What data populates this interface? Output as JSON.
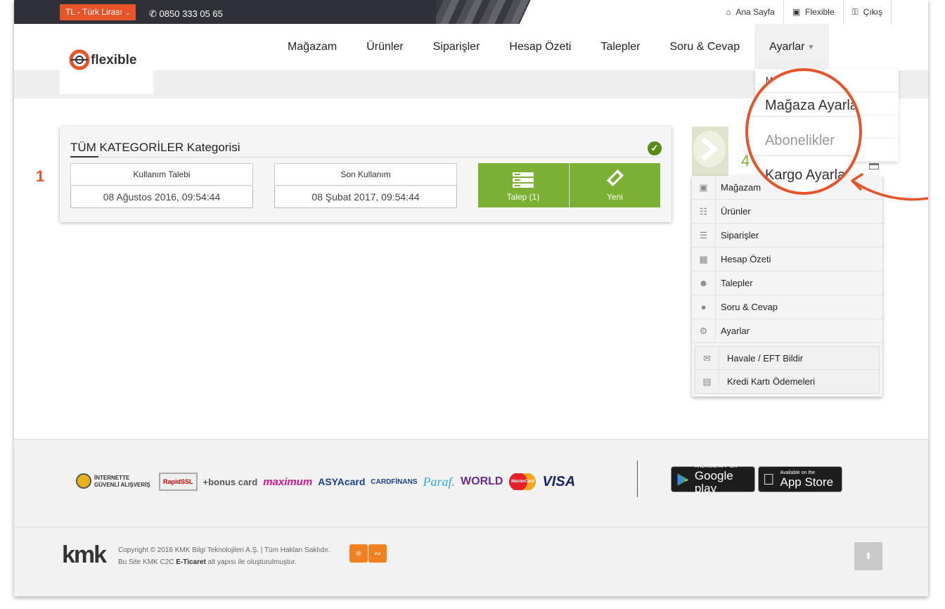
{
  "topbar": {
    "currency": "TL - Türk Lirası",
    "phone": "0850 333 05 65",
    "links": [
      {
        "label": "Ana Sayfa",
        "icon": "home-icon"
      },
      {
        "label": "Flexible",
        "icon": "cube-icon"
      },
      {
        "label": "Çıkış",
        "icon": "unlock-icon"
      }
    ]
  },
  "logo_text": "flexible",
  "nav": {
    "items": [
      "Mağazam",
      "Ürünler",
      "Siparişler",
      "Hesap Özeti",
      "Talepler",
      "Soru & Cevap"
    ],
    "active": "Ayarlar"
  },
  "dropdown": {
    "items": [
      "Mağaza Ayarları",
      "Mağaza Ayarları",
      "Abonelikler",
      "Kargo Ayarları"
    ]
  },
  "zoom": {
    "items": [
      "Mağaza Ayarları",
      "Abonelikler",
      "Kargo Ayarları"
    ]
  },
  "row_number": "1",
  "card": {
    "title": "TÜM KATEGORİLER Kategorisi",
    "usage_request_label": "Kullanım Talebi",
    "usage_request_value": "08 Ağustos 2016, 09:54:44",
    "last_usage_label": "Son Kullanım",
    "last_usage_value": "08 Şubat 2017, 09:54:44",
    "request_button": "Talep (1)",
    "new_button": "Yeni"
  },
  "side": {
    "count": "4",
    "menu": [
      {
        "label": "Mağazam",
        "icon": "cube-icon"
      },
      {
        "label": "Ürünler",
        "icon": "barcode-icon"
      },
      {
        "label": "Siparişler",
        "icon": "list-icon"
      },
      {
        "label": "Hesap Özeti",
        "icon": "calculator-icon"
      },
      {
        "label": "Talepler",
        "icon": "users-icon"
      },
      {
        "label": "Soru & Cevap",
        "icon": "comment-icon"
      },
      {
        "label": "Ayarlar",
        "icon": "cogs-icon"
      }
    ],
    "submenu": [
      {
        "label": "Havale / EFT Bildir",
        "icon": "megaphone-icon"
      },
      {
        "label": "Kredi Kartı Ödemeleri",
        "icon": "credit-card-icon"
      }
    ]
  },
  "footer": {
    "payments": [
      "İNTERNETTE GÜVENLİ ALIŞVERİŞ",
      "RapidSSL",
      "+bonus card",
      "maximum",
      "ASYAcard",
      "CARDFİNANS",
      "Paraf.",
      "WORLD",
      "MasterCard",
      "VISA"
    ],
    "android_small": "ANDROID APP ON",
    "android_big": "Google play",
    "apple_small": "Available on the",
    "apple_big": "App Store",
    "kmk": "kmk",
    "copyright_line1": "Copyright © 2016 KMK Bilgi Teknolojileri A.Ş. | Tüm Hakları Saklıdır.",
    "copyright_line2_pre": "Bu Site KMK C2C",
    "copyright_line2_bold": "E-Ticaret",
    "copyright_line2_post": "alt yapısı ile oluşturulmuştur."
  },
  "colors": {
    "accent": "#e8542a",
    "green": "#7cb034",
    "dark": "#303038"
  }
}
